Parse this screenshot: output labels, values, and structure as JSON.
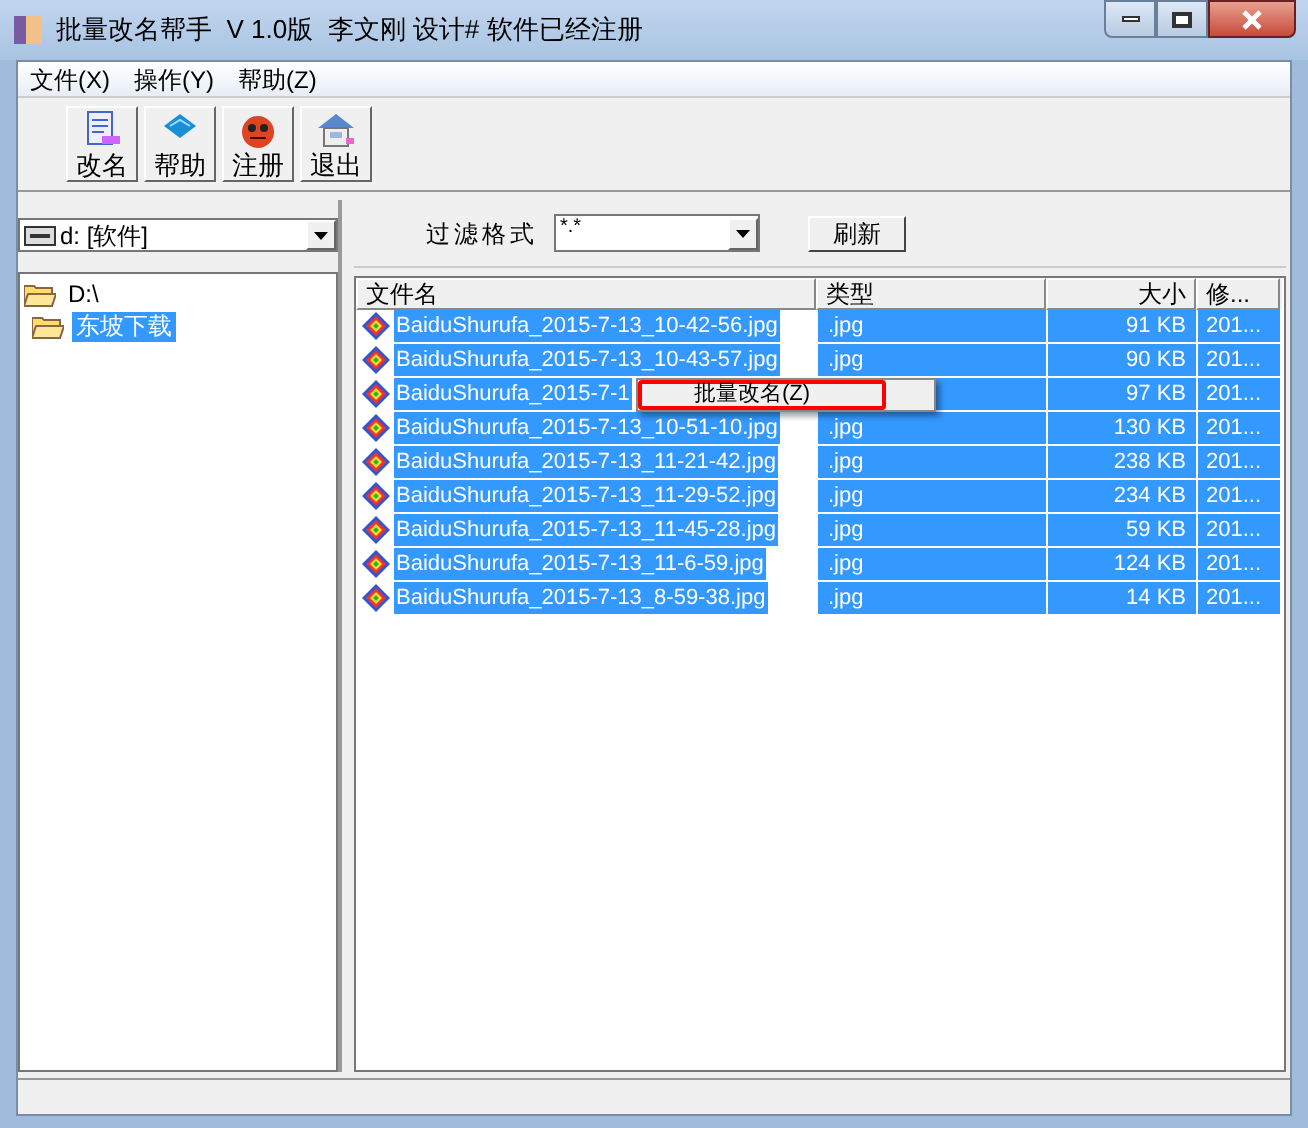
{
  "window": {
    "title": "批量改名帮手  V 1.0版  李文刚 设计# 软件已经注册"
  },
  "menu": [
    "文件(X)",
    "操作(Y)",
    "帮助(Z)"
  ],
  "toolbar": [
    {
      "kind": "rename",
      "label": "改名"
    },
    {
      "kind": "help",
      "label": "帮助"
    },
    {
      "kind": "register",
      "label": "注册"
    },
    {
      "kind": "exit",
      "label": "退出"
    }
  ],
  "drive": {
    "value": "d: [软件]"
  },
  "tree": [
    {
      "label": "D:\\",
      "selected": false,
      "children": [
        {
          "label": "东坡下载",
          "selected": true
        }
      ]
    }
  ],
  "filter": {
    "label": "过滤格式",
    "value": "*.*",
    "refresh": "刷新"
  },
  "table": {
    "columns": [
      "文件名",
      "类型",
      "大小",
      "修..."
    ],
    "rows": [
      {
        "name": "BaiduShurufa_2015-7-13_10-42-56.jpg",
        "type": ".jpg",
        "size": "91 KB",
        "date": "201...",
        "selected": true
      },
      {
        "name": "BaiduShurufa_2015-7-13_10-43-57.jpg",
        "type": ".jpg",
        "size": "90 KB",
        "date": "201...",
        "selected": true
      },
      {
        "name": "BaiduShurufa_2015-7-1",
        "size": "97 KB",
        "date": "201...",
        "selected": true
      },
      {
        "name": "BaiduShurufa_2015-7-13_10-51-10.jpg",
        "type": ".jpg",
        "size": "130 KB",
        "date": "201...",
        "selected": true
      },
      {
        "name": "BaiduShurufa_2015-7-13_11-21-42.jpg",
        "type": ".jpg",
        "size": "238 KB",
        "date": "201...",
        "selected": true
      },
      {
        "name": "BaiduShurufa_2015-7-13_11-29-52.jpg",
        "type": ".jpg",
        "size": "234 KB",
        "date": "201...",
        "selected": true
      },
      {
        "name": "BaiduShurufa_2015-7-13_11-45-28.jpg",
        "type": ".jpg",
        "size": "59 KB",
        "date": "201...",
        "selected": true
      },
      {
        "name": "BaiduShurufa_2015-7-13_11-6-59.jpg",
        "type": ".jpg",
        "size": "124 KB",
        "date": "201...",
        "selected": true
      },
      {
        "name": "BaiduShurufa_2015-7-13_8-59-38.jpg",
        "type": ".jpg",
        "size": "14 KB",
        "date": "201...",
        "selected": true
      }
    ]
  },
  "context_menu": {
    "items": [
      "批量改名(Z)"
    ],
    "highlighted": true
  }
}
